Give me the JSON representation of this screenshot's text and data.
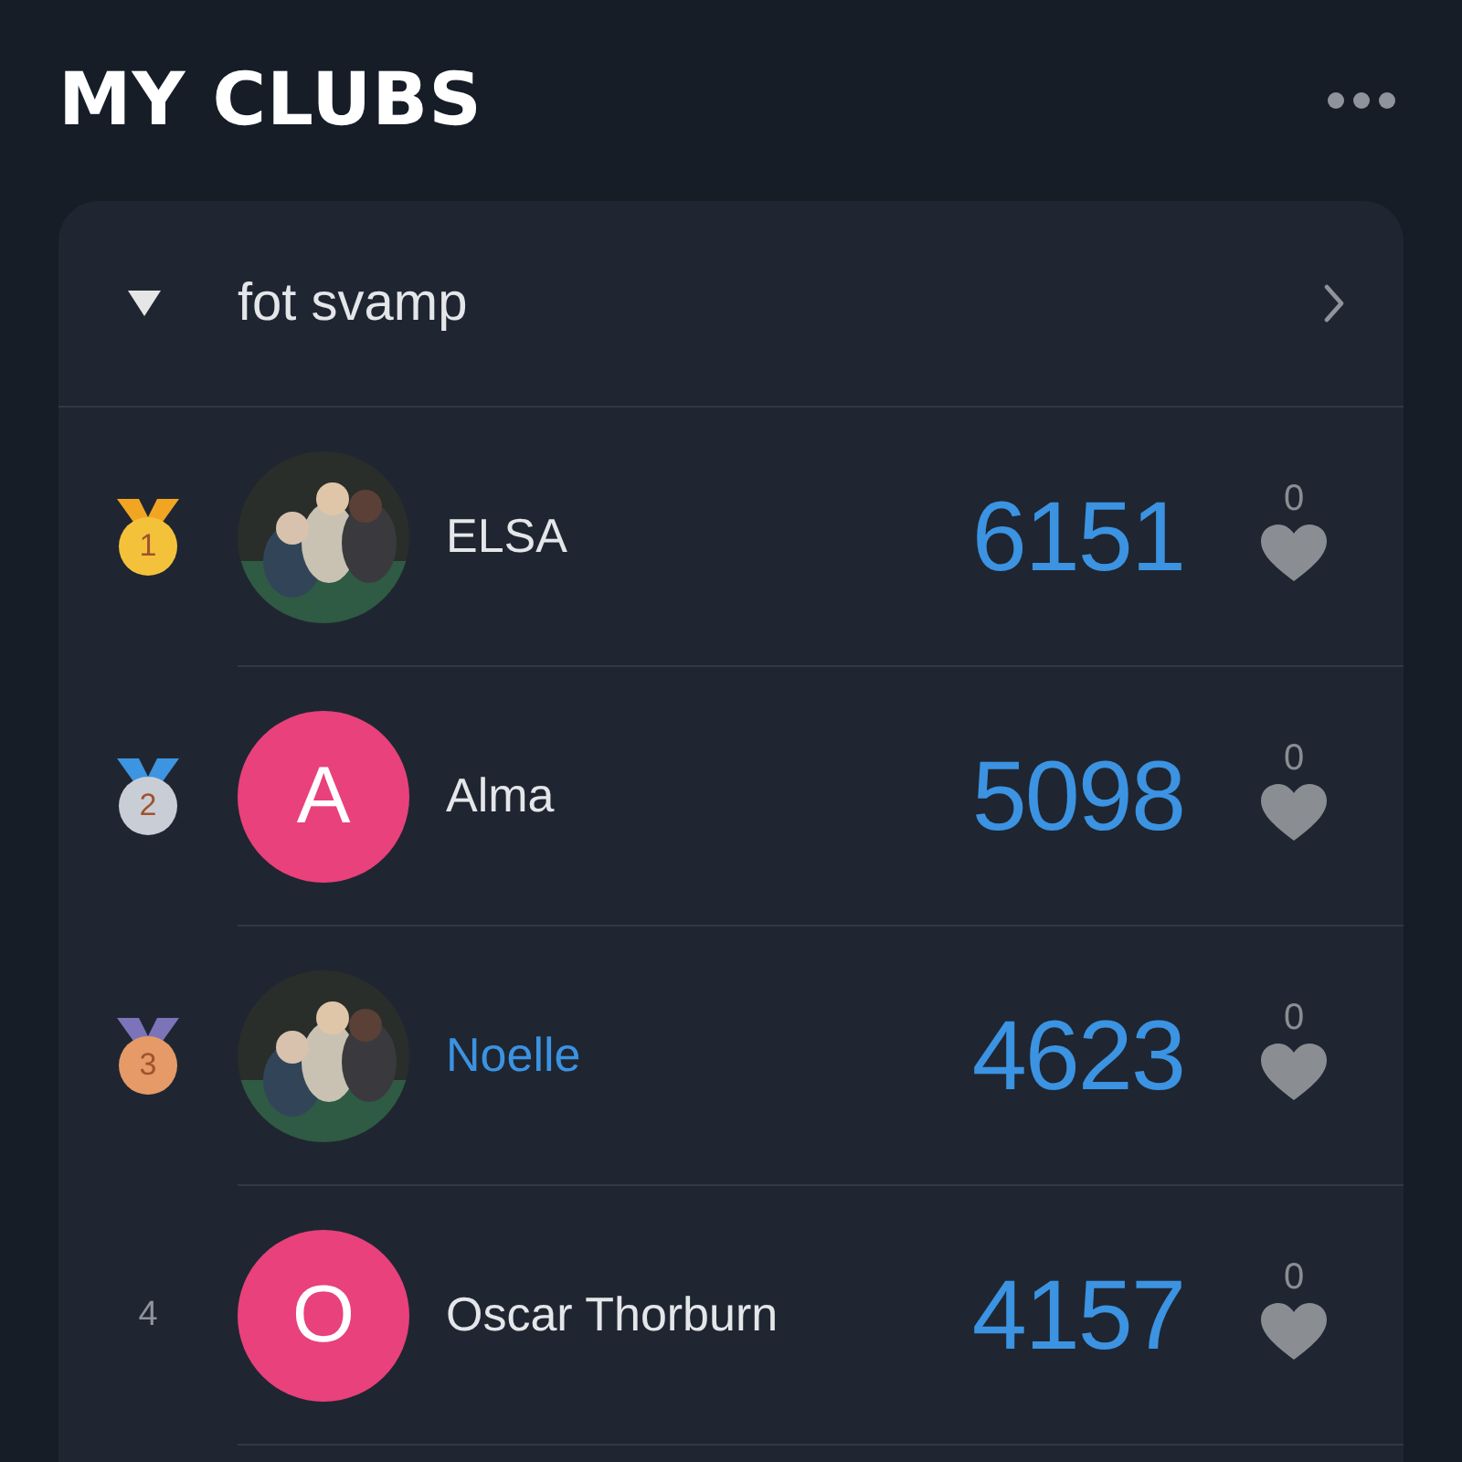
{
  "title": "MY CLUBS",
  "club": {
    "name": "fot svamp",
    "expanded": true,
    "members": [
      {
        "rank": {
          "kind": "medal",
          "label": "1",
          "color": "#f4c23a"
        },
        "name": "ELSA",
        "highlighted": false,
        "score": "6151",
        "likes": "0"
      },
      {
        "rank": {
          "kind": "medal",
          "label": "2",
          "color": "#c9ced6"
        },
        "avatar": {
          "kind": "initial",
          "letter": "A",
          "color": "#e8417b"
        },
        "name": "Alma",
        "highlighted": false,
        "score": "5098",
        "likes": "0"
      },
      {
        "rank": {
          "kind": "medal",
          "label": "3",
          "color": "#e59a68"
        },
        "name": "Noelle",
        "highlighted": true,
        "score": "4623",
        "likes": "0"
      },
      {
        "rank": {
          "kind": "plain",
          "label": "4"
        },
        "avatar": {
          "kind": "initial",
          "letter": "O",
          "color": "#e8417b"
        },
        "name": "Oscar Thorburn",
        "highlighted": false,
        "score": "4157",
        "likes": "0"
      }
    ]
  }
}
